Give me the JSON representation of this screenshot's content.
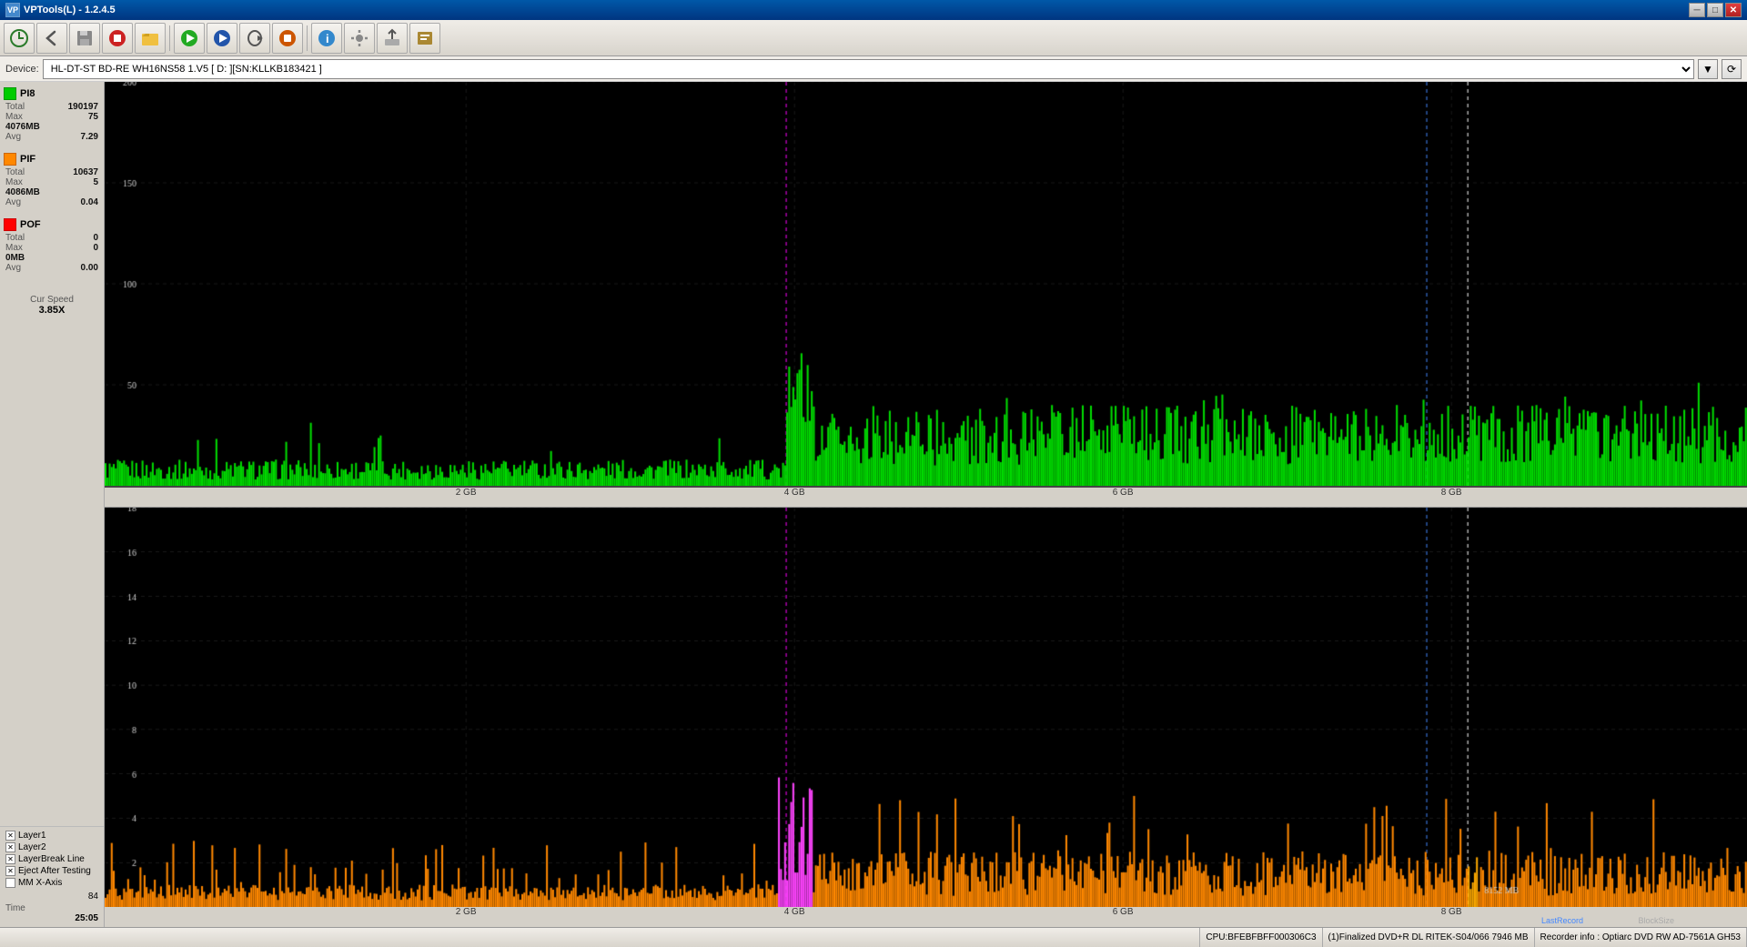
{
  "titleBar": {
    "title": "VPTools(L) - 1.2.4.5",
    "icon": "VP"
  },
  "toolbar": {
    "buttons": [
      {
        "name": "recycle-btn",
        "icon": "♻",
        "label": "Recycle"
      },
      {
        "name": "back-btn",
        "icon": "◀",
        "label": "Back"
      },
      {
        "name": "save-btn",
        "icon": "💾",
        "label": "Save"
      },
      {
        "name": "stop-btn",
        "icon": "🛑",
        "label": "Stop"
      },
      {
        "name": "open-btn",
        "icon": "📂",
        "label": "Open"
      },
      {
        "name": "forward-btn",
        "icon": "▶",
        "label": "Forward"
      },
      {
        "name": "play-btn",
        "icon": "▶",
        "label": "Play"
      },
      {
        "name": "play2-btn",
        "icon": "▶",
        "label": "Play2"
      },
      {
        "name": "stop2-btn",
        "icon": "⏹",
        "label": "Stop2"
      },
      {
        "name": "rec-btn",
        "icon": "⏺",
        "label": "Record"
      },
      {
        "name": "info-btn",
        "icon": "ℹ",
        "label": "Info"
      },
      {
        "name": "tools-btn",
        "icon": "🔧",
        "label": "Tools"
      },
      {
        "name": "export-btn",
        "icon": "📤",
        "label": "Export"
      }
    ]
  },
  "deviceBar": {
    "label": "Device:",
    "deviceName": "HL-DT-ST BD-RE  WH16NS58  1.V5  [ D: ][SN:KLLKB183421 ]"
  },
  "leftPanel": {
    "pi8": {
      "label": "PI8",
      "color": "#00cc00",
      "total_label": "Total",
      "total_value": "190197",
      "max_label": "Max",
      "max_value": "75",
      "size1_label": "4076MB",
      "avg_label": "Avg",
      "avg_value": "7.29"
    },
    "pif": {
      "label": "PIF",
      "color": "#ff8800",
      "total_label": "Total",
      "total_value": "10637",
      "max_label": "Max",
      "max_value": "5",
      "size1_label": "4086MB",
      "avg_label": "Avg",
      "avg_value": "0.04"
    },
    "pof": {
      "label": "POF",
      "color": "#ff0000",
      "total_label": "Total",
      "total_value": "0",
      "max_label": "Max",
      "max_value": "0",
      "size1_label": "0MB",
      "avg_label": "Avg",
      "avg_value": "0.00"
    },
    "curSpeed": {
      "label": "Cur Speed",
      "value": "3.85X"
    }
  },
  "xAxis": {
    "labels": [
      "2 GB",
      "4 GB",
      "6 GB",
      "8 GB"
    ]
  },
  "xAxis2": {
    "labels": [
      "2 GB",
      "4 GB",
      "6 GB",
      "8 GB"
    ]
  },
  "bottomLeft": {
    "layer1_label": "Layer1",
    "layer2_label": "Layer2",
    "layerbreak_label": "LayerBreak Line",
    "eject_label": "Eject After Testing",
    "mmx_label": "MM X-Axis",
    "value1": "84",
    "time_label": "Time",
    "time_value": "25:05"
  },
  "statusBar": {
    "segment1": "",
    "segment2": "CPU:BFEBFBFF000306C3",
    "segment3": "(1)Finalized  DVD+R DL  RITEK-S04/066  7946 MB",
    "segment4": "Recorder info : Optiarc DVD RW AD-7561A   GH53"
  },
  "chart1": {
    "yLabels": [
      "200",
      "150",
      "100",
      "50"
    ],
    "yMax": 200
  },
  "chart2": {
    "yLabels": [
      "18",
      "16",
      "14",
      "12",
      "10",
      "8",
      "6",
      "4",
      "2"
    ],
    "yMax": 18,
    "annotations": {
      "lastRecord": "LastRecord",
      "blockSize": "BlockSize",
      "mb8152": "8152 MB"
    }
  }
}
